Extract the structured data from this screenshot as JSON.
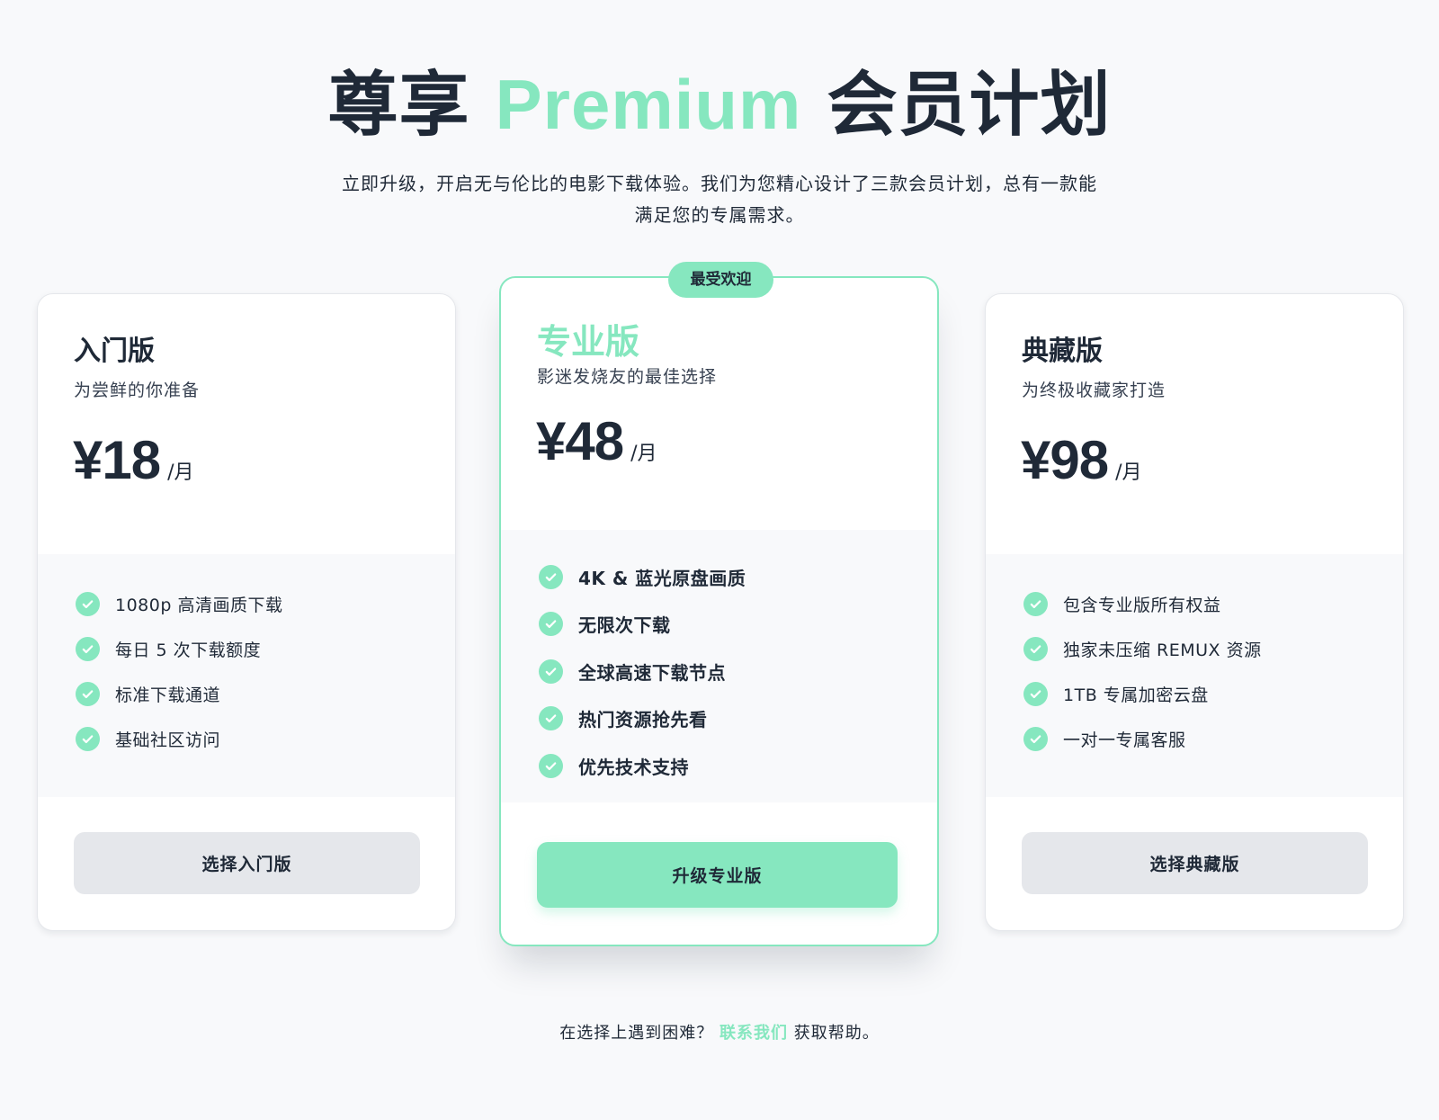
{
  "hero": {
    "title_part1": "尊享 ",
    "title_accent": "Premium",
    "title_part2": " 会员计划",
    "subtitle": "立即升级，开启无与伦比的电影下载体验。我们为您精心设计了三款会员计划，总有一款能满足您的专属需求。"
  },
  "colors": {
    "accent": "#86e7bf",
    "text": "#1f2937",
    "background": "#f8f9fb",
    "button_gray": "#e5e7eb"
  },
  "plans": [
    {
      "name": "入门版",
      "description": "为尝鲜的你准备",
      "price": "¥18",
      "unit": "/月",
      "features": [
        "1080p 高清画质下载",
        "每日 5 次下载额度",
        "标准下载通道",
        "基础社区访问"
      ],
      "button": "选择入门版"
    },
    {
      "badge": "最受欢迎",
      "name": "专业版",
      "description": "影迷发烧友的最佳选择",
      "price": "¥48",
      "unit": "/月",
      "features": [
        "4K & 蓝光原盘画质",
        "无限次下载",
        "全球高速下载节点",
        "热门资源抢先看",
        "优先技术支持"
      ],
      "button": "升级专业版"
    },
    {
      "name": "典藏版",
      "description": "为终极收藏家打造",
      "price": "¥98",
      "unit": "/月",
      "features": [
        "包含专业版所有权益",
        "独家未压缩 REMUX 资源",
        "1TB 专属加密云盘",
        "一对一专属客服"
      ],
      "button": "选择典藏版"
    }
  ],
  "footer": {
    "prefix": "在选择上遇到困难？ ",
    "link": "联系我们",
    "suffix": " 获取帮助。"
  }
}
